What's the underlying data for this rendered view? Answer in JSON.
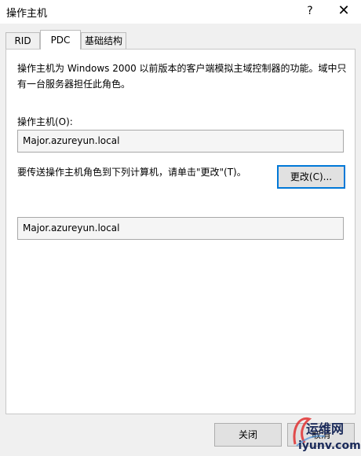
{
  "window": {
    "title": "操作主机",
    "help_label": "?",
    "close_label": "✕"
  },
  "tabs": [
    {
      "label": "RID",
      "active": false
    },
    {
      "label": "PDC",
      "active": true
    },
    {
      "label": "基础结构",
      "active": false
    }
  ],
  "pdc": {
    "description": "操作主机为 Windows 2000 以前版本的客户端模拟主域控制器的功能。域中只有一台服务器担任此角色。",
    "owner_label": "操作主机(O):",
    "owner_value": "Major.azureyun.local",
    "transfer_text": "要传送操作主机角色到下列计算机，请单击\"更改\"(T)。",
    "change_button": "更改(C)...",
    "target_value": "Major.azureyun.local"
  },
  "footer": {
    "close_button": "关闭",
    "cancel_button": "取消"
  },
  "watermark": {
    "brand": "运维网",
    "site": "iyunv.com"
  },
  "colors": {
    "accent": "#0078d7",
    "watermark": "#e03030"
  }
}
